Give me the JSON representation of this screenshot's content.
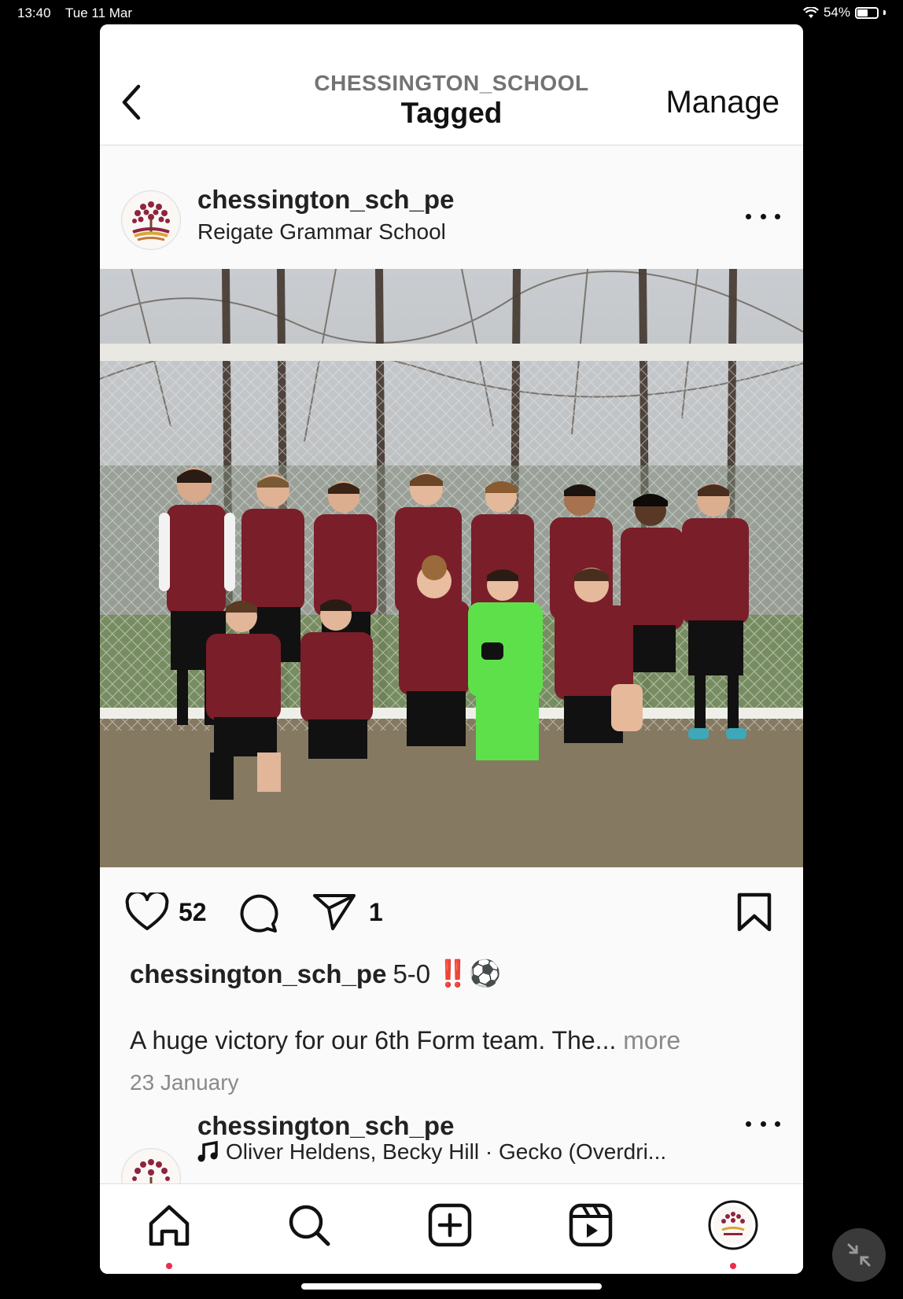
{
  "status_bar": {
    "time": "13:40",
    "date": "Tue 11 Mar",
    "battery": "54%",
    "battery_level": 0.54
  },
  "header": {
    "subtitle": "CHESSINGTON_SCHOOL",
    "title": "Tagged",
    "manage_label": "Manage"
  },
  "post": {
    "username": "chessington_sch_pe",
    "location": "Reigate Grammar School",
    "likes": "52",
    "shares": "1",
    "caption_user": "chessington_sch_pe",
    "caption_text": "5-0",
    "caption_emojis": "‼️⚽",
    "caption_line2": "A huge victory for our 6th Form team. The...",
    "more_label": "more",
    "date": "23 January"
  },
  "next_post": {
    "username": "chessington_sch_pe",
    "audio": "Oliver Heldens, Becky Hill · Gecko (Overdri..."
  },
  "tabbar": {
    "items": [
      "home-tab",
      "search-tab",
      "create-tab",
      "reels-tab",
      "profile-tab"
    ],
    "active_dot_color": "#ed2b4f"
  },
  "colors": {
    "kit_maroon": "#7a1e2a",
    "keeper_green": "#5ee04a",
    "accent": "#ed2b4f"
  }
}
